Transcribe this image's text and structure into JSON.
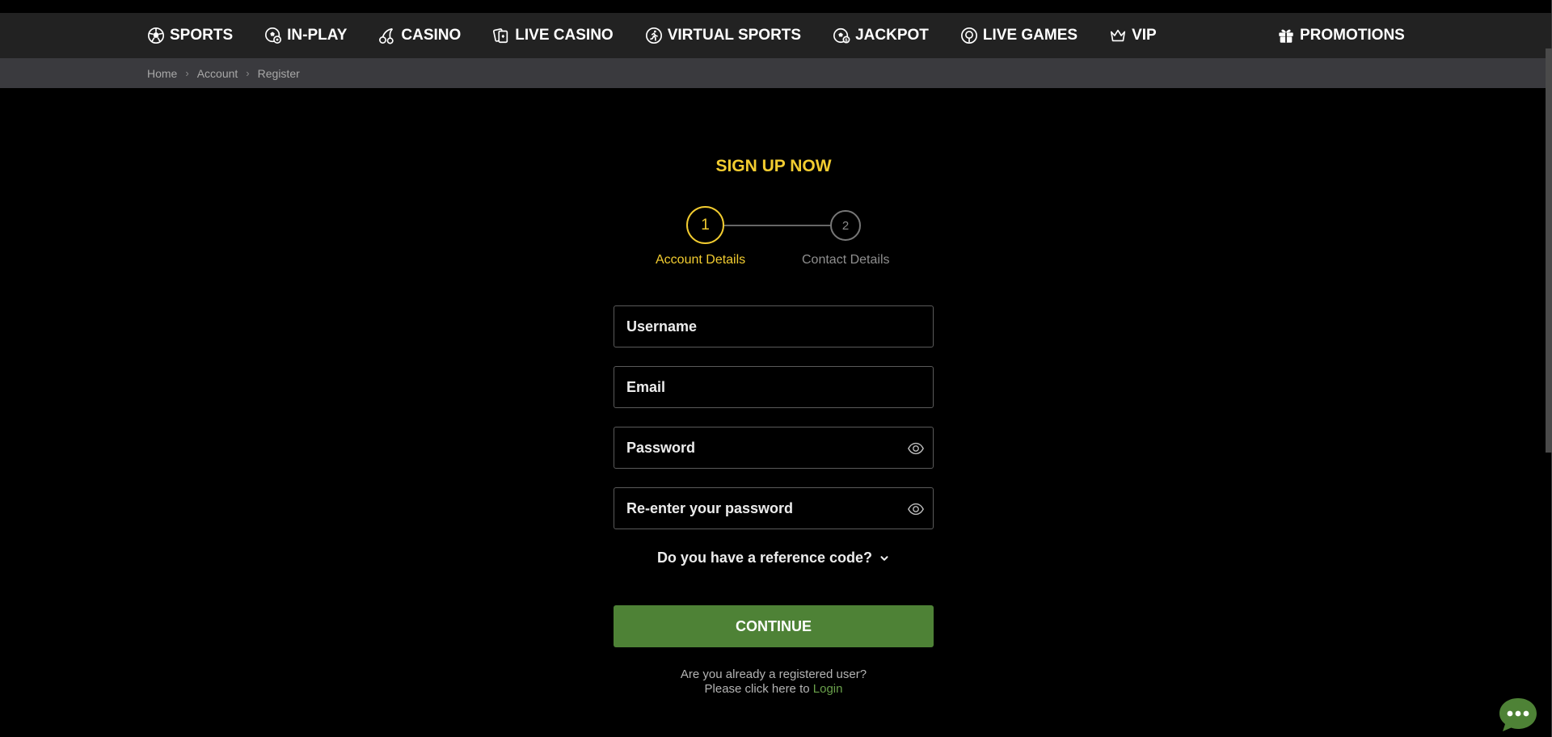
{
  "nav": {
    "items": [
      {
        "label": "SPORTS",
        "icon": "soccer-ball-icon"
      },
      {
        "label": "IN-PLAY",
        "icon": "live-ball-icon"
      },
      {
        "label": "CASINO",
        "icon": "cherry-icon"
      },
      {
        "label": "LIVE CASINO",
        "icon": "cards-icon"
      },
      {
        "label": "VIRTUAL SPORTS",
        "icon": "virtual-runner-icon"
      },
      {
        "label": "JACKPOT",
        "icon": "jackpot-ball-icon"
      },
      {
        "label": "LIVE GAMES",
        "icon": "live-games-icon"
      },
      {
        "label": "VIP",
        "icon": "crown-icon"
      }
    ],
    "promotions": {
      "label": "PROMOTIONS",
      "icon": "gift-icon"
    }
  },
  "breadcrumb": [
    "Home",
    "Account",
    "Register"
  ],
  "signup": {
    "title": "SIGN UP NOW",
    "steps": [
      {
        "number": "1",
        "label": "Account Details"
      },
      {
        "number": "2",
        "label": "Contact Details"
      }
    ],
    "fields": {
      "username_placeholder": "Username",
      "email_placeholder": "Email",
      "password_placeholder": "Password",
      "repassword_placeholder": "Re-enter your password"
    },
    "reference_code": "Do you have a reference code?",
    "continue_label": "CONTINUE",
    "registered_line1": "Are you already a registered user?",
    "registered_line2": "Please click here to",
    "login_label": "Login"
  },
  "colors": {
    "accent": "#f2cc30",
    "continue_button": "#4e8236",
    "login_link": "#6aa14b",
    "navbar": "#222222",
    "breadcrumb_bar": "#3a3a3e"
  }
}
